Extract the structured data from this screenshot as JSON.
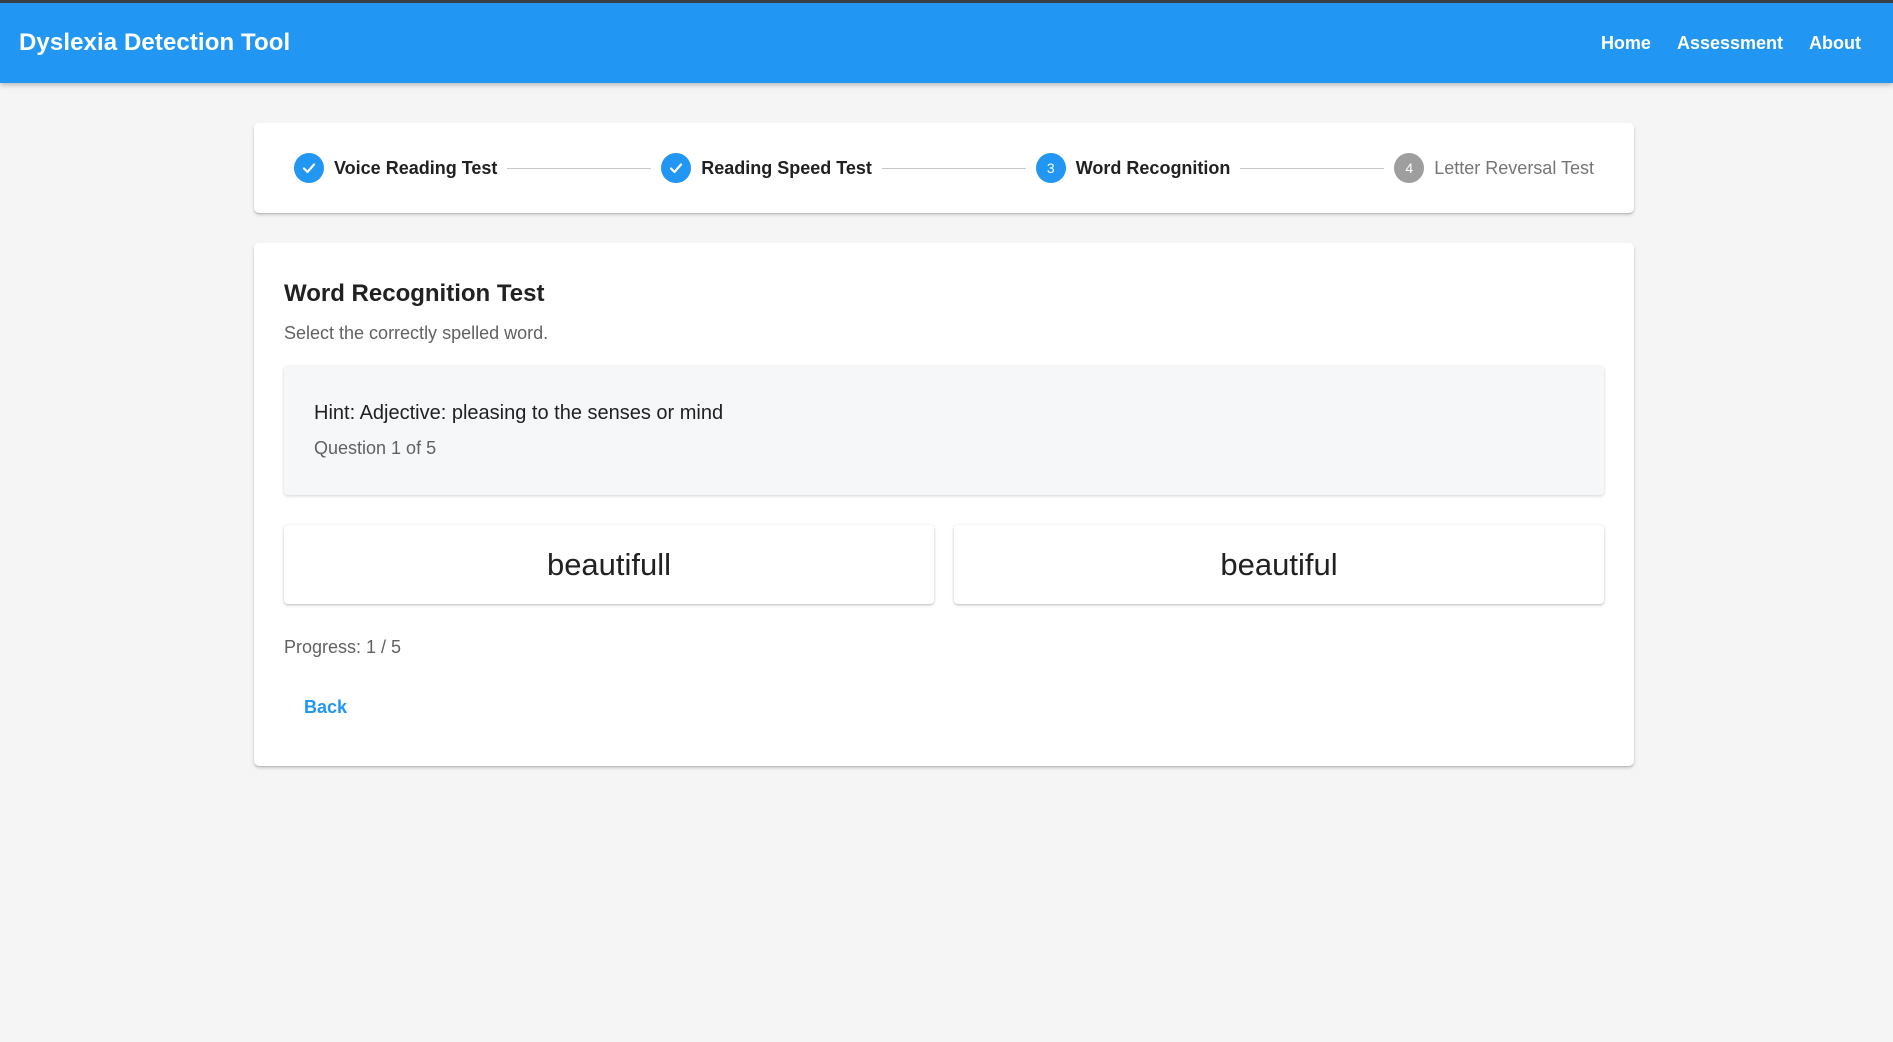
{
  "app": {
    "title": "Dyslexia Detection Tool",
    "nav": [
      "Home",
      "Assessment",
      "About"
    ]
  },
  "stepper": {
    "steps": [
      {
        "number": "1",
        "label": "Voice Reading Test",
        "state": "completed"
      },
      {
        "number": "2",
        "label": "Reading Speed Test",
        "state": "completed"
      },
      {
        "number": "3",
        "label": "Word Recognition",
        "state": "active"
      },
      {
        "number": "4",
        "label": "Letter Reversal Test",
        "state": "pending"
      }
    ]
  },
  "test": {
    "title": "Word Recognition Test",
    "instruction": "Select the correctly spelled word.",
    "hint": "Hint: Adjective: pleasing to the senses or mind",
    "question": "Question 1 of 5",
    "options": [
      "beautifull",
      "beautiful"
    ],
    "progress": "Progress: 1 / 5",
    "back_label": "Back"
  },
  "colors": {
    "primary": "#2196f3",
    "pending_step": "#9e9e9e",
    "background": "#f5f5f5"
  },
  "icons": {
    "completed_step": "check-icon"
  }
}
